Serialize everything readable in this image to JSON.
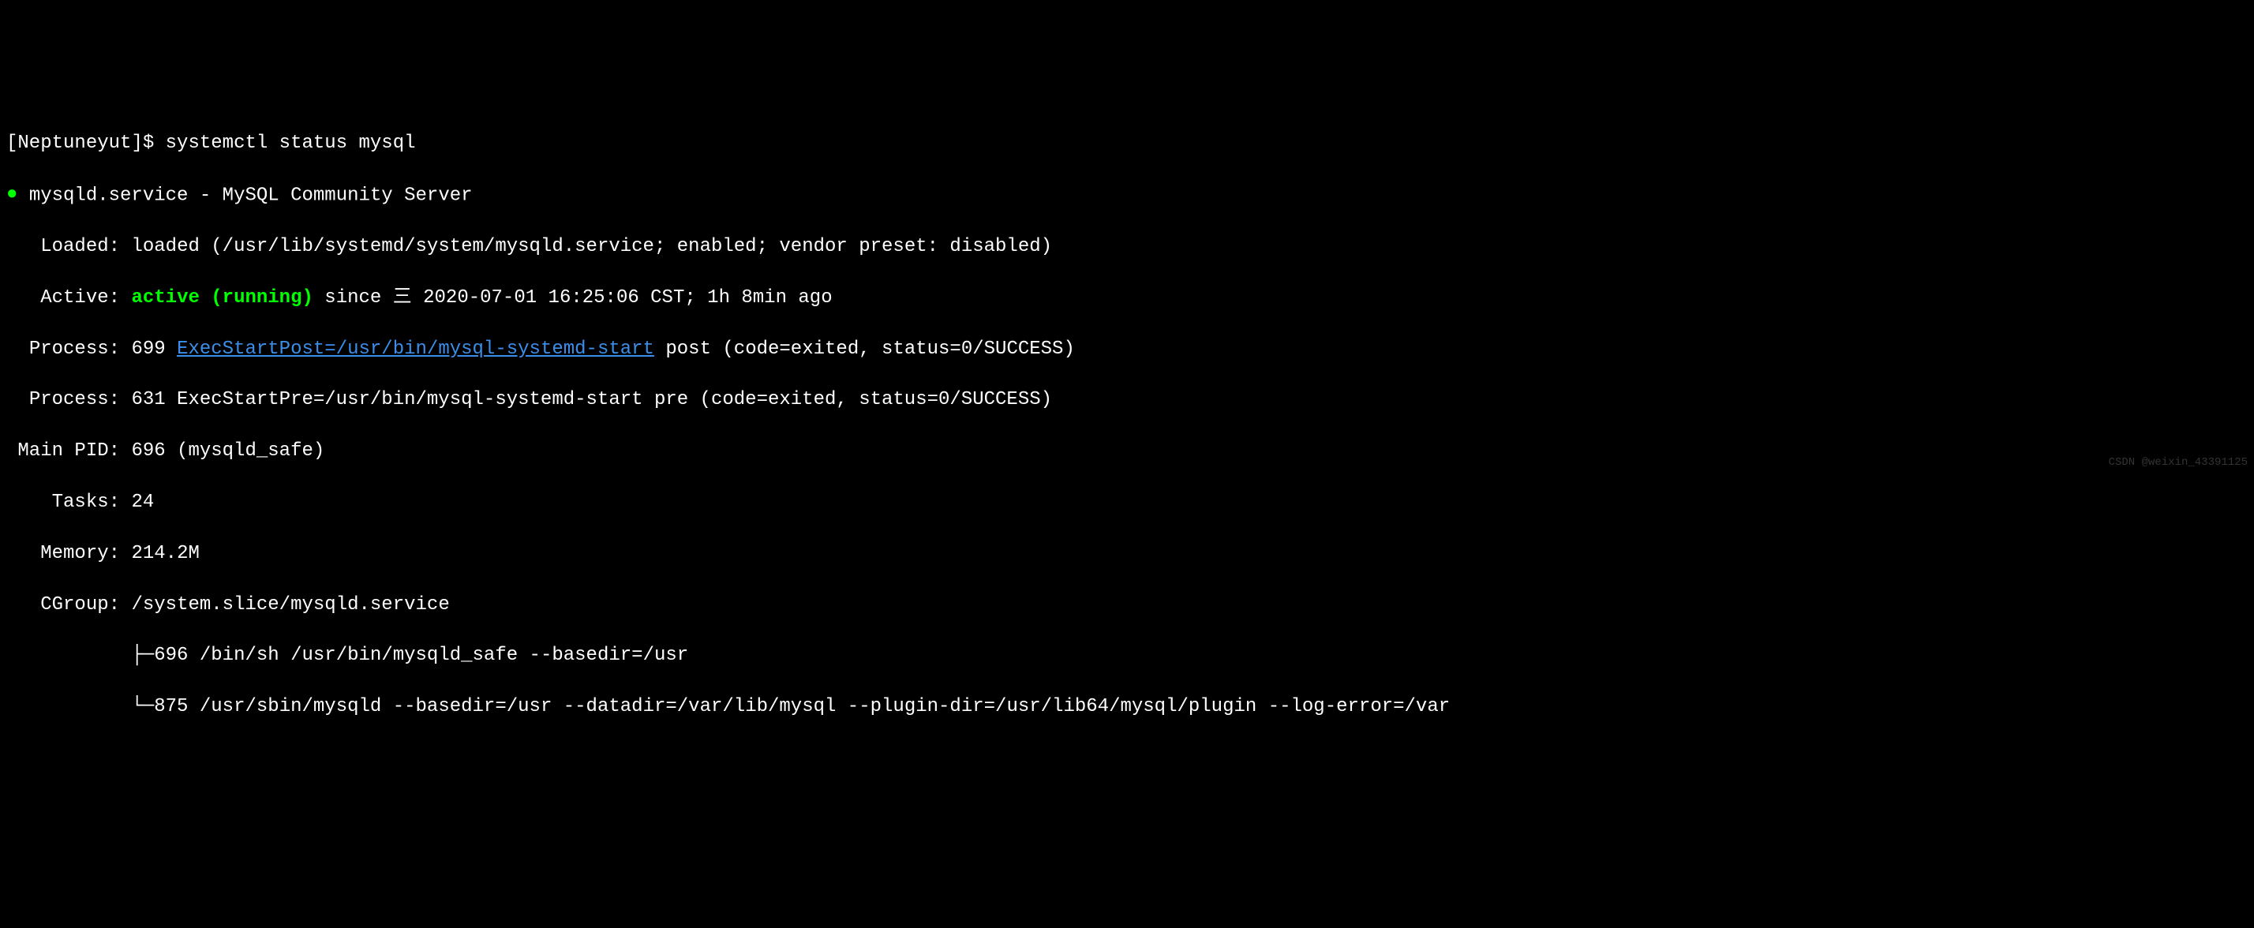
{
  "prompt": {
    "user_host": "Neptuneyut",
    "command": "systemctl status mysql"
  },
  "service": {
    "name": "mysqld.service",
    "description": "MySQL Community Server"
  },
  "loaded": {
    "label": "Loaded:",
    "value": "loaded (/usr/lib/systemd/system/mysqld.service; enabled; vendor preset: disabled)"
  },
  "active": {
    "label": "Active:",
    "state": "active (running)",
    "since": "since 三 2020-07-01 16:25:06 CST; 1h 8min ago"
  },
  "process1": {
    "label": "Process:",
    "pid": "699",
    "exec": "ExecStartPost=/usr/bin/mysql-systemd-start",
    "suffix": "post (code=exited, status=0/SUCCESS)"
  },
  "process2": {
    "label": "Process:",
    "value": "631 ExecStartPre=/usr/bin/mysql-systemd-start pre (code=exited, status=0/SUCCESS)"
  },
  "mainpid": {
    "label": "Main PID:",
    "value": "696 (mysqld_safe)"
  },
  "tasks": {
    "label": "Tasks:",
    "value": "24"
  },
  "memory": {
    "label": "Memory:",
    "value": "214.2M"
  },
  "cgroup": {
    "label": "CGroup:",
    "value": "/system.slice/mysqld.service"
  },
  "tree": {
    "line1_pid": "696",
    "line1_cmd": "/bin/sh /usr/bin/mysqld_safe --basedir=/usr",
    "line2_pid": "875",
    "line2_cmd": "/usr/sbin/mysqld --basedir=/usr --datadir=/var/lib/mysql --plugin-dir=/usr/lib64/mysql/plugin --log-error=/var"
  },
  "watermark": "CSDN @weixin_43391125"
}
